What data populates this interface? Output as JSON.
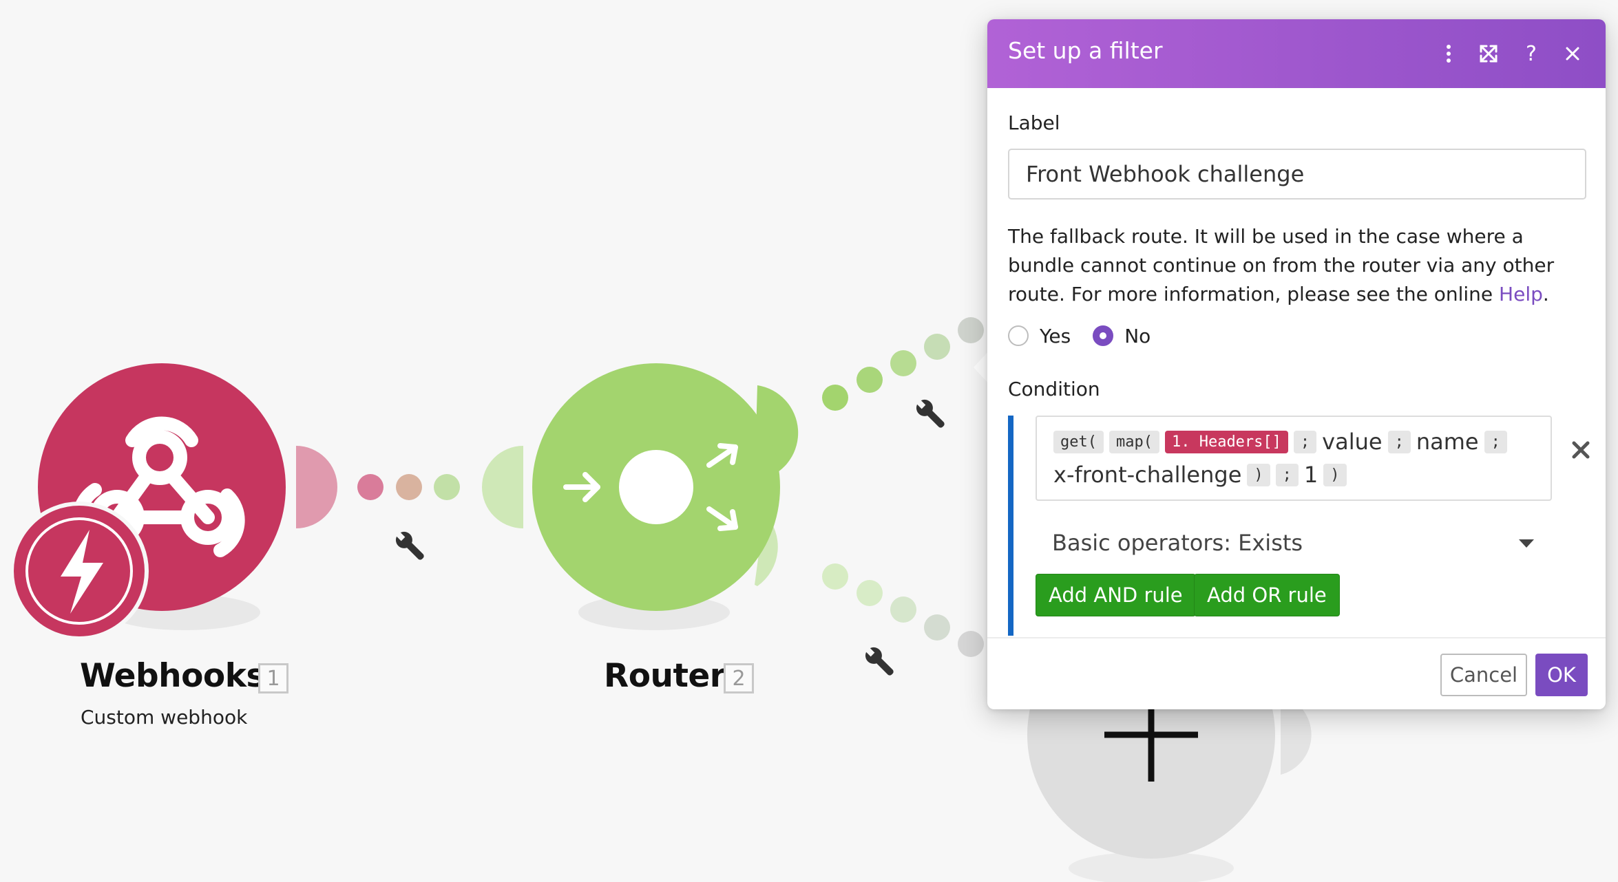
{
  "canvas": {
    "modules": [
      {
        "title": "Webhooks",
        "badge": "1",
        "subtitle": "Custom webhook",
        "icon": "webhook-icon",
        "overlay_icon": "lightning-icon",
        "color": "#c6365f"
      },
      {
        "title": "Router",
        "badge": "2",
        "icon": "router-icon",
        "color": "#a3d46e"
      }
    ],
    "add_module_icon": "plus-icon",
    "link_tool_icon": "wrench-icon"
  },
  "dialog": {
    "title": "Set up a filter",
    "header_icons": [
      "more-vertical-icon",
      "expand-icon",
      "help-icon",
      "close-icon"
    ],
    "label_field": {
      "label": "Label",
      "value": "Front Webhook challenge"
    },
    "help_text": "The fallback route. It will be used in the case where a bundle cannot continue on from the router via any other route. For more information, please see the online",
    "help_link": "Help",
    "help_suffix": ".",
    "fallback": {
      "options": [
        "Yes",
        "No"
      ],
      "selected": "No"
    },
    "condition": {
      "label": "Condition",
      "line1": [
        {
          "kind": "token",
          "text": "get("
        },
        {
          "kind": "token",
          "text": "map("
        },
        {
          "kind": "pill",
          "text": "1. Headers[]"
        },
        {
          "kind": "token",
          "text": ";"
        },
        {
          "kind": "text",
          "text": "value"
        },
        {
          "kind": "token",
          "text": ";"
        },
        {
          "kind": "text",
          "text": "name"
        },
        {
          "kind": "token",
          "text": ";"
        }
      ],
      "line2": [
        {
          "kind": "text",
          "text": "x-front-challenge"
        },
        {
          "kind": "token",
          "text": ")"
        },
        {
          "kind": "token",
          "text": ";"
        },
        {
          "kind": "text",
          "text": "1"
        },
        {
          "kind": "token",
          "text": ")"
        }
      ],
      "operator": "Basic operators: Exists"
    },
    "add_and_rule": "Add AND rule",
    "add_or_rule": "Add OR rule",
    "cancel": "Cancel",
    "ok": "OK"
  },
  "colors": {
    "header_gradient_start": "#b162d6",
    "header_gradient_end": "#8e4ec6",
    "accent_purple": "#7a4cc0",
    "condition_bar": "#1467c4",
    "green_button": "#2a9d1e",
    "pill": "#c8385e"
  }
}
